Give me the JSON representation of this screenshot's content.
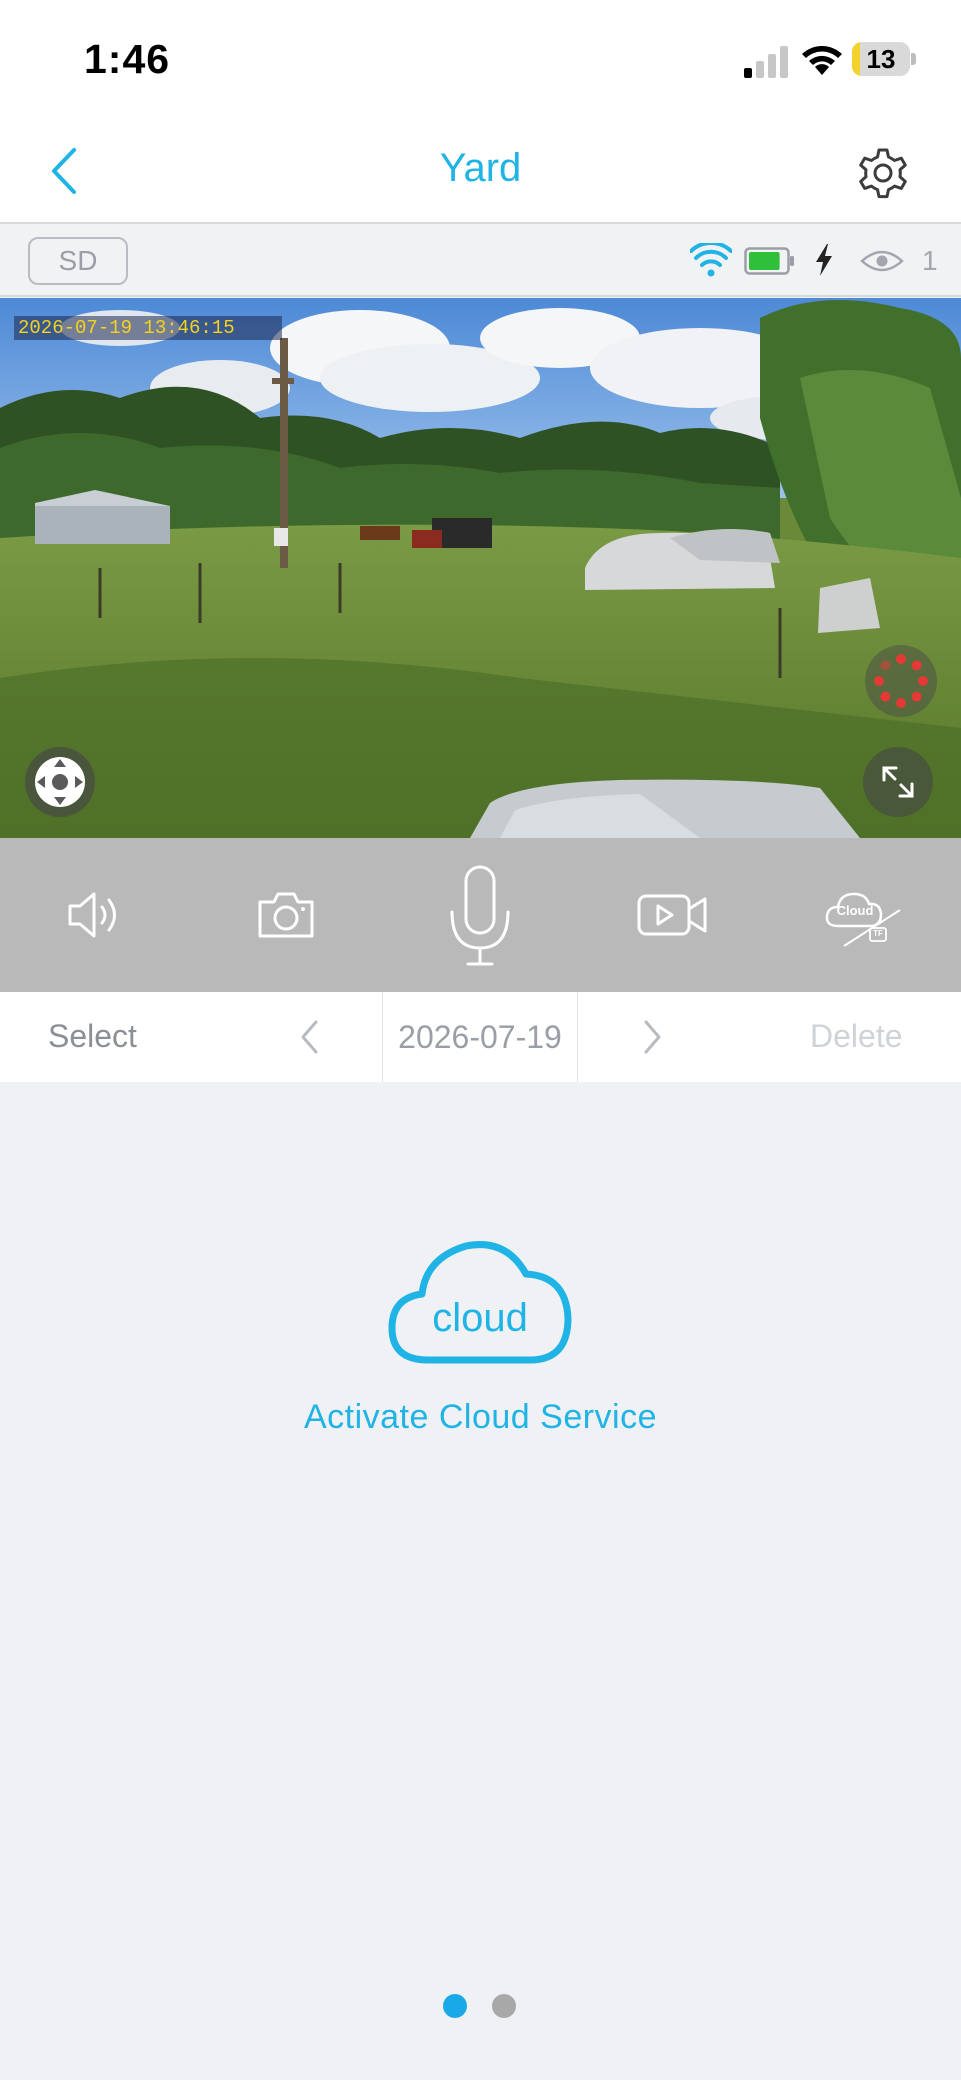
{
  "status_bar": {
    "time": "1:46",
    "battery_percent": "13",
    "battery_level": 0.13,
    "signal_bars": 1
  },
  "header": {
    "title": "Yard",
    "back_icon": "chevron-left-icon",
    "settings_icon": "gear-icon"
  },
  "device_status": {
    "storage_badge": "SD",
    "wifi_icon": "wifi-icon",
    "battery_icon": "battery-icon",
    "battery_level": 0.85,
    "charging_icon": "bolt-icon",
    "viewer_icon": "eye-icon",
    "viewer_count": "1"
  },
  "video": {
    "timestamp": "2026-07-19 13:46:15",
    "ptz_icon": "ptz-joystick-icon",
    "loading_icon": "loading-spinner-icon",
    "fullscreen_icon": "expand-icon"
  },
  "controls": [
    {
      "name": "speaker-button",
      "icon": "speaker-icon"
    },
    {
      "name": "snapshot-button",
      "icon": "camera-icon"
    },
    {
      "name": "talk-button",
      "icon": "microphone-icon"
    },
    {
      "name": "record-button",
      "icon": "video-record-icon"
    },
    {
      "name": "cloud-tf-button",
      "icon": "cloud-tf-icon",
      "label": "Cloud",
      "sub_label": "TF"
    }
  ],
  "playback": {
    "select_label": "Select",
    "date": "2026-07-19",
    "delete_label": "Delete"
  },
  "cloud": {
    "icon_text": "cloud",
    "activate_label": "Activate Cloud Service"
  },
  "pagination": {
    "pages": 2,
    "active": 1
  },
  "colors": {
    "accent": "#1fb3e6",
    "control_bar": "#b9b9b9",
    "background": "#eff1f4",
    "osd_text": "#f5d21b",
    "loading": "#e53935"
  }
}
